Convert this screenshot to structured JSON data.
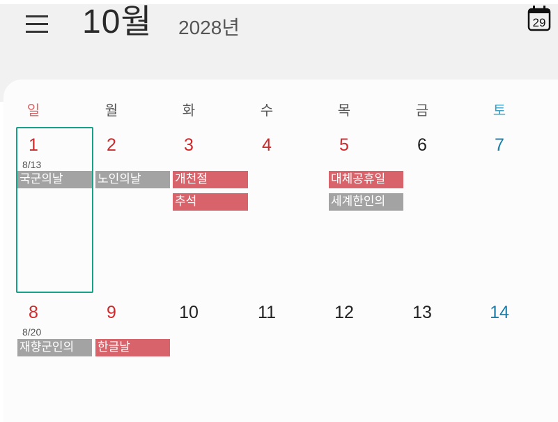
{
  "header": {
    "month_label": "10월",
    "year_label": "2028년",
    "today_badge": "29"
  },
  "weekdays": [
    "일",
    "월",
    "화",
    "수",
    "목",
    "금",
    "토"
  ],
  "weeks": [
    {
      "days": [
        "1",
        "2",
        "3",
        "4",
        "5",
        "6",
        "7"
      ],
      "lunar": "8/13",
      "events": [
        "국군의날",
        "노인의날",
        "개천절",
        "추석",
        "대체공휴일",
        "세계한인의"
      ]
    },
    {
      "days": [
        "8",
        "9",
        "10",
        "11",
        "12",
        "13",
        "14"
      ],
      "lunar": "8/20",
      "events": [
        "재향군인의",
        "한글날"
      ]
    }
  ],
  "colors": {
    "holiday_red": "#d0282b",
    "saturday_blue": "#1b7ea8",
    "event_gray": "#a3a3a3",
    "event_red": "#d9636a",
    "selection_green": "#16a288"
  },
  "icons": {
    "menu": "hamburger-menu-icon",
    "today": "calendar-today-icon"
  }
}
